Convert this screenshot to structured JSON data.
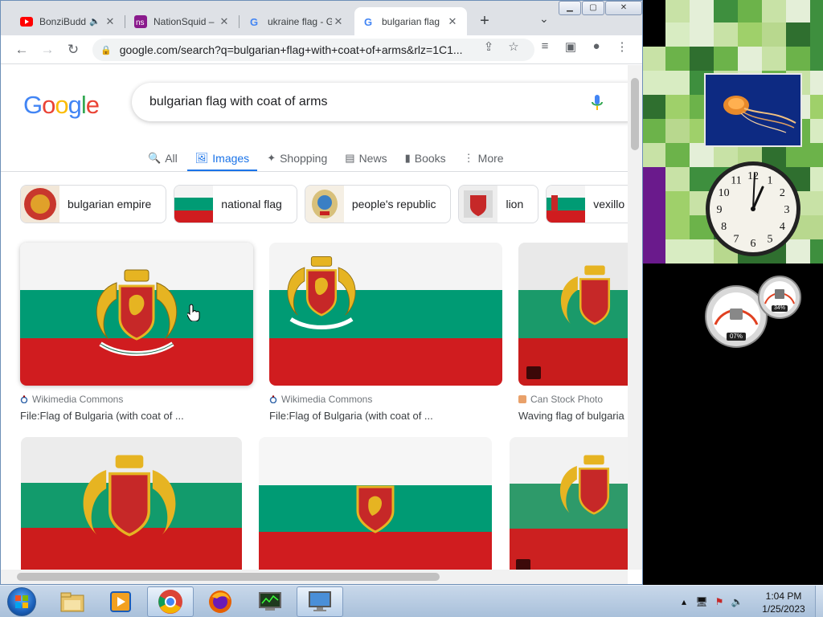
{
  "browser": {
    "tabs": [
      {
        "title": "BonziBuddy",
        "icon": "youtube-icon",
        "audio": true
      },
      {
        "title": "NationSquid – ",
        "icon": "nationsquid-icon"
      },
      {
        "title": "ukraine flag - G",
        "icon": "google-icon"
      },
      {
        "title": "bulgarian flag",
        "icon": "google-icon",
        "active": true
      }
    ],
    "url": "google.com/search?q=bulgarian+flag+with+coat+of+arms&rlz=1C1..."
  },
  "google": {
    "logo_letters": [
      "G",
      "o",
      "o",
      "g",
      "l",
      "e"
    ],
    "logo_colors": [
      "#4285f4",
      "#ea4335",
      "#fbbc05",
      "#4285f4",
      "#34a853",
      "#ea4335"
    ],
    "query": "bulgarian flag with coat of arms",
    "nav": [
      "All",
      "Images",
      "Shopping",
      "News",
      "Books",
      "More"
    ],
    "active_nav": "Images",
    "chips": [
      "bulgarian empire",
      "national flag",
      "people's republic",
      "lion",
      "vexillo"
    ],
    "results": [
      {
        "source": "Wikimedia Commons",
        "title": "File:Flag of Bulgaria (with coat of ..."
      },
      {
        "source": "Wikimedia Commons",
        "title": "File:Flag of Bulgaria (with coat of ..."
      },
      {
        "source": "Can Stock Photo",
        "title": "Waving flag of bulgaria"
      }
    ]
  },
  "flag_colors": {
    "white": "#f4f4f4",
    "green": "#009b74",
    "red": "#d01c1f"
  },
  "gadgets": {
    "cpu_meter_value": "07%",
    "memory_meter_value": "34%",
    "clock_numbers": [
      "12",
      "1",
      "2",
      "3",
      "4",
      "5",
      "6",
      "7",
      "8",
      "9",
      "10",
      "11"
    ]
  },
  "taskbar": {
    "time": "1:04 PM",
    "date": "1/25/2023"
  }
}
